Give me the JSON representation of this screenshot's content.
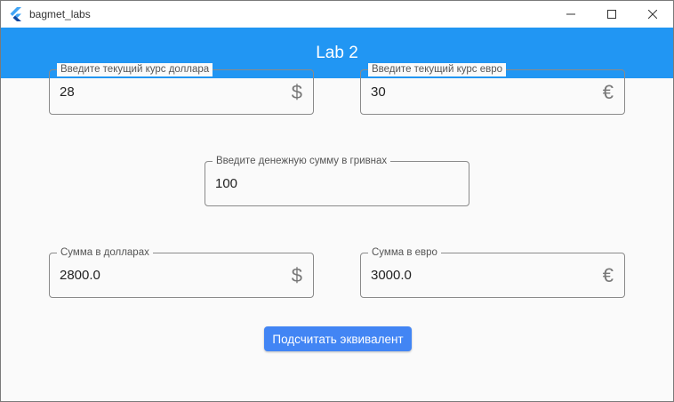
{
  "window": {
    "title": "bagmet_labs",
    "icon": "flutter-logo-icon"
  },
  "appbar": {
    "title": "Lab 2",
    "color": "#2196f3"
  },
  "fields": {
    "usd_rate": {
      "label": "Введите текущий курс доллара",
      "value": "28",
      "suffix": "$"
    },
    "eur_rate": {
      "label": "Введите текущий курс евро",
      "value": "30",
      "suffix": "€"
    },
    "uah_amount": {
      "label": "Введите денежную сумму в гривнах",
      "value": "100"
    },
    "usd_sum": {
      "label": "Сумма в  долларах",
      "value": "2800.0",
      "suffix": "$"
    },
    "eur_sum": {
      "label": "Сумма в  евро",
      "value": "3000.0",
      "suffix": "€"
    }
  },
  "button": {
    "label": "Подсчитать эквивалент",
    "color": "#4285f4"
  }
}
